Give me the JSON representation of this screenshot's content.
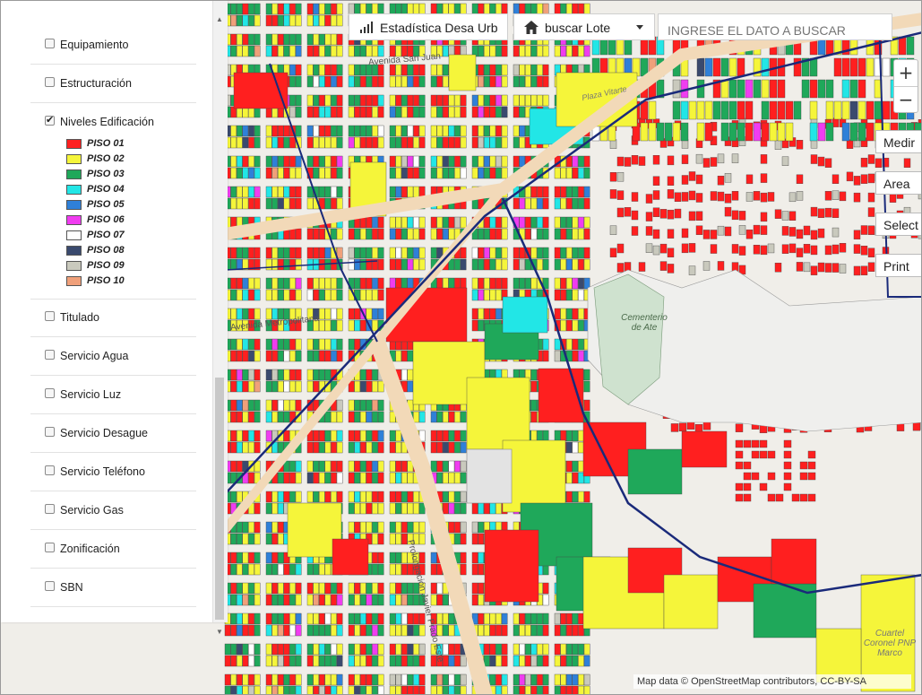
{
  "panel": {
    "layers": [
      {
        "label": "Equipamiento",
        "checked": false
      },
      {
        "label": "Estructuración",
        "checked": false
      },
      {
        "label": "Niveles Edificación",
        "checked": true
      },
      {
        "label": "Titulado",
        "checked": false
      },
      {
        "label": "Servicio Agua",
        "checked": false
      },
      {
        "label": "Servicio Luz",
        "checked": false
      },
      {
        "label": "Servicio Desague",
        "checked": false
      },
      {
        "label": "Servicio Teléfono",
        "checked": false
      },
      {
        "label": "Servicio Gas",
        "checked": false
      },
      {
        "label": "Zonificación",
        "checked": false
      },
      {
        "label": "SBN",
        "checked": false
      }
    ],
    "legend": [
      {
        "label": "PISO 01",
        "color": "#ff1f1f"
      },
      {
        "label": "PISO 02",
        "color": "#f5f53a"
      },
      {
        "label": "PISO 03",
        "color": "#1fa85a"
      },
      {
        "label": "PISO 04",
        "color": "#22e6e6"
      },
      {
        "label": "PISO 05",
        "color": "#2f80d8"
      },
      {
        "label": "PISO 06",
        "color": "#f03cf0"
      },
      {
        "label": "PISO 07",
        "color": "#ffffff"
      },
      {
        "label": "PISO 08",
        "color": "#3a4a6e"
      },
      {
        "label": "PISO 09",
        "color": "#c9c9bd"
      },
      {
        "label": "PISO 10",
        "color": "#f0a07a"
      }
    ]
  },
  "toolbar": {
    "stats_label": "Estadística Desa Urb",
    "stats_icon": "bar-chart-icon",
    "search_lote_label": "buscar Lote",
    "search_lote_icon": "home-icon",
    "search_placeholder": "INGRESE EL DATO A BUSCAR"
  },
  "map_controls": {
    "zoom_in": "+",
    "zoom_out": "−",
    "tools": [
      "Medir",
      "Area",
      "Select",
      "Print"
    ]
  },
  "map_labels": {
    "cemetery": "Cementerio de Ate",
    "street_1": "Prolongación Javier Prado Este",
    "street_2": "Avenida Metropolitana",
    "street_3": "Avenida San Juan",
    "quartel": "Cuartel Coronel PNP Marco",
    "plaza": "Plaza Vitarte"
  },
  "attribution": "Map data © OpenStreetMap contributors, CC-BY-SA",
  "colors": {
    "road_blue": "#1a2a7a",
    "major_road": "#f2d9b8",
    "cemetery_green": "#cfe2cf"
  }
}
